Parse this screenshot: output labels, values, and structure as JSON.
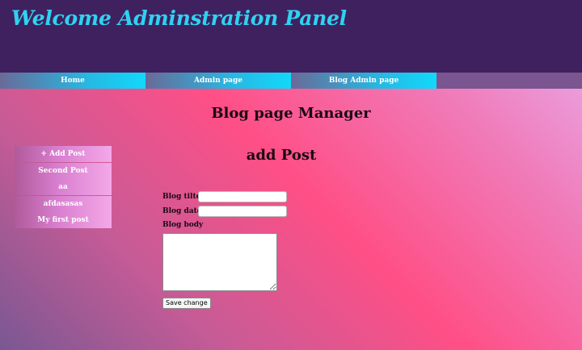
{
  "header": {
    "title": "Welcome Adminstration Panel"
  },
  "nav": {
    "items": [
      {
        "label": "Home"
      },
      {
        "label": "Admin page"
      },
      {
        "label": "Blog Admin page"
      }
    ]
  },
  "main": {
    "heading": "Blog page Manager",
    "section_heading": "add Post"
  },
  "sidebar": {
    "items": [
      {
        "label": "+ Add Post"
      },
      {
        "label": "Second Post"
      },
      {
        "label": "aa"
      },
      {
        "label": "afdasasas"
      },
      {
        "label": "My first post"
      }
    ]
  },
  "form": {
    "title_label": "Blog tilte",
    "title_value": "",
    "date_label": "Blog date",
    "date_value": "",
    "body_label": "Blog body",
    "body_value": "",
    "save_label": "Save change"
  },
  "colors": {
    "header_bg": "#3f2160",
    "title_color": "#2fd2f0",
    "nav_accent": "#12d8fb",
    "page_gradient_mid": "#ff4f86"
  }
}
